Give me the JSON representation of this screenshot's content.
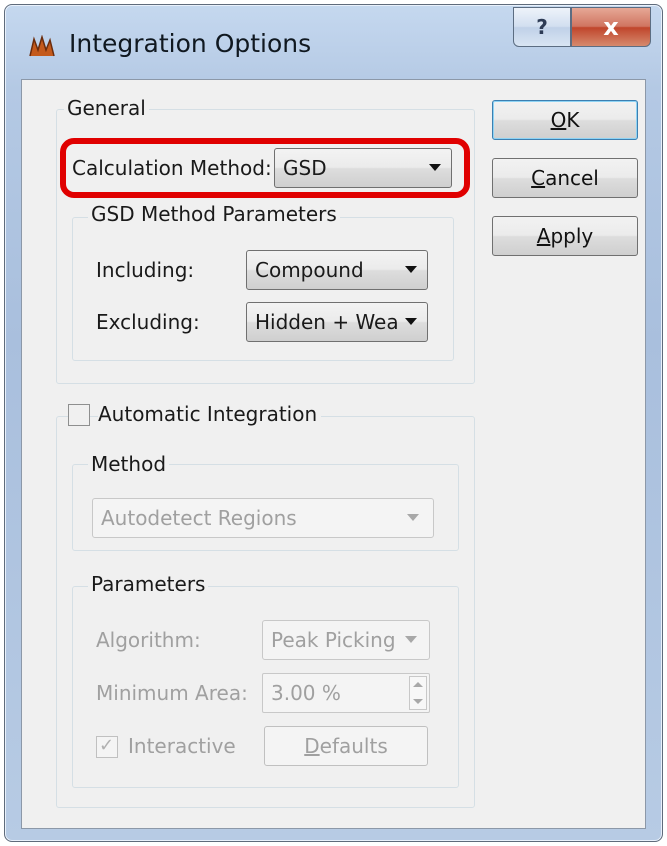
{
  "window": {
    "title": "Integration Options",
    "help_glyph": "?",
    "close_glyph": "x",
    "icon": "app-icon"
  },
  "general": {
    "title": "General",
    "calculation_method_label": "Calculation Method:",
    "calculation_method_value": "GSD",
    "gsd": {
      "title": "GSD Method Parameters",
      "including_label": "Including:",
      "including_value": "Compound",
      "excluding_label": "Excluding:",
      "excluding_value": "Hidden + Wea"
    }
  },
  "auto": {
    "checkbox_label": "Automatic Integration",
    "checked": false,
    "method": {
      "title": "Method",
      "value": "Autodetect Regions"
    },
    "parameters": {
      "title": "Parameters",
      "algorithm_label": "Algorithm:",
      "algorithm_value": "Peak Picking",
      "min_area_label": "Minimum Area:",
      "min_area_value": "3.00 %",
      "interactive_label": "Interactive",
      "interactive_checked": true,
      "defaults_label": "Defaults"
    }
  },
  "buttons": {
    "ok": "OK",
    "cancel": "Cancel",
    "apply": "Apply"
  },
  "colors": {
    "highlight": "#e00000",
    "close": "#c0462c"
  }
}
